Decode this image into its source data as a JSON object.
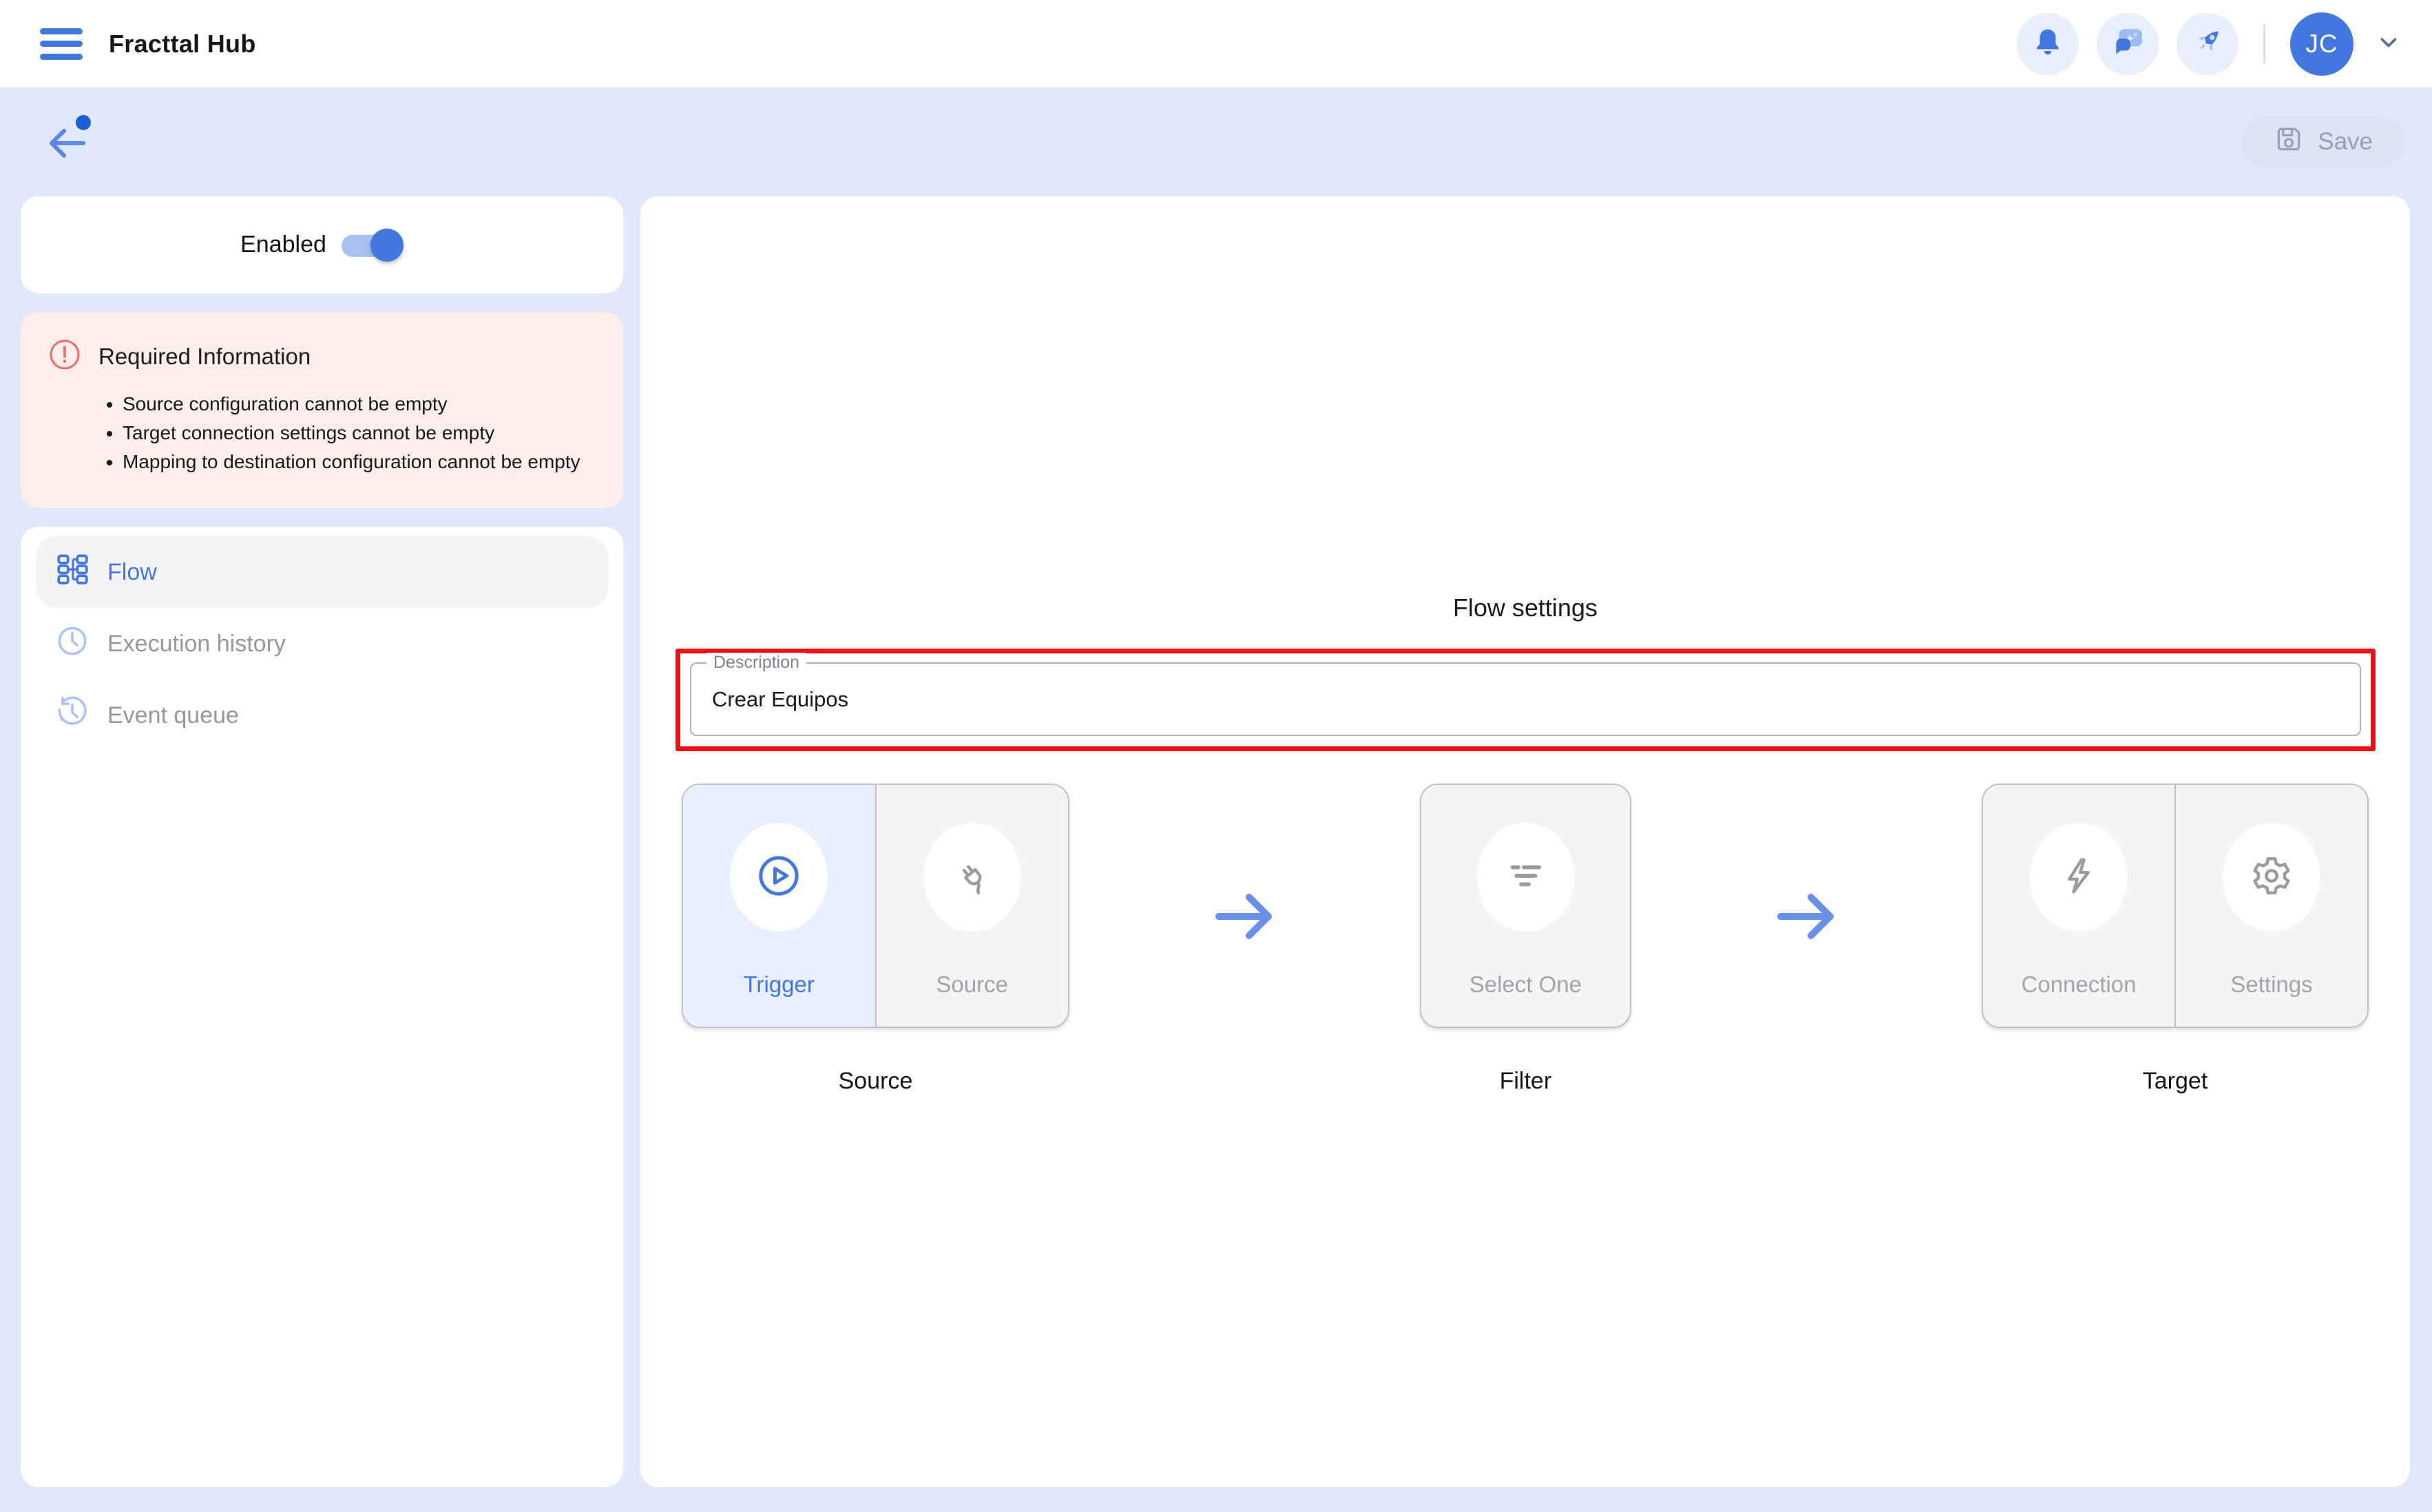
{
  "header": {
    "title": "Fracttal Hub",
    "avatar_initials": "JC",
    "icons": [
      "menu-icon",
      "notifications-bell-icon",
      "assistant-chat-sparkles-icon",
      "rocket-icon",
      "chevron-down-icon"
    ]
  },
  "toolbar": {
    "save_label": "Save",
    "back_icon": "arrow-left-icon",
    "unsaved_indicator": "blue-dot"
  },
  "sidebar": {
    "enabled_label": "Enabled",
    "enabled_state": "on",
    "alert": {
      "title": "Required Information",
      "items": [
        "Source configuration cannot be empty",
        "Target connection settings cannot be empty",
        "Mapping to destination configuration cannot be empty"
      ]
    },
    "nav": [
      {
        "label": "Flow",
        "icon": "workflow-icon",
        "active": true
      },
      {
        "label": "Execution history",
        "icon": "clock-icon",
        "active": false
      },
      {
        "label": "Event queue",
        "icon": "history-clock-icon",
        "active": false
      }
    ]
  },
  "main": {
    "title": "Flow settings",
    "description_field": {
      "label": "Description",
      "value": "Crear Equipos",
      "annotated": "red-highlight-box"
    },
    "flow": {
      "source": {
        "label": "Source",
        "options": [
          {
            "label": "Trigger",
            "icon": "play-circle-icon",
            "active": true
          },
          {
            "label": "Source",
            "icon": "plug-icon",
            "active": false
          }
        ]
      },
      "filter": {
        "label": "Filter",
        "options": [
          {
            "label": "Select One",
            "icon": "filter-icon",
            "active": false
          }
        ]
      },
      "target": {
        "label": "Target",
        "options": [
          {
            "label": "Connection",
            "icon": "lightning-icon",
            "active": false
          },
          {
            "label": "Settings",
            "icon": "gear-icon",
            "active": false
          }
        ]
      }
    }
  },
  "colors": {
    "accent_blue": "#4377e0",
    "light_blue_bg": "#e0e9fc",
    "arrow_blue": "#6a90ea",
    "alert_bg": "#fdedeb",
    "alert_red": "#ea6d66",
    "annotation_red": "#ee1111",
    "muted_grey": "#a4a4a8",
    "card_grey": "#f4f4f6"
  }
}
